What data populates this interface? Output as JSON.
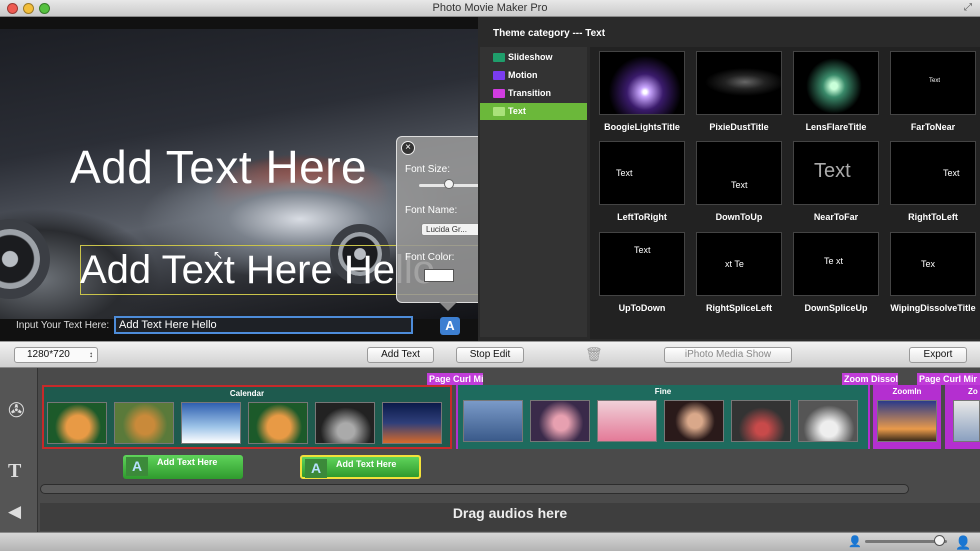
{
  "window": {
    "title": "Photo Movie Maker Pro"
  },
  "preview": {
    "overlay_text_1": "Add Text Here",
    "overlay_text_2": "Add Text Here Hello",
    "input_label": "Input Your Text Here:",
    "input_value": "Add Text Here Hello"
  },
  "font_popover": {
    "size_label": "Font Size:",
    "name_label": "Font Name:",
    "font_name_value": "Lucida Gr...",
    "color_label": "Font Color:",
    "font_size_level": 0.4
  },
  "theme": {
    "header": "Theme category --- Text",
    "categories": [
      {
        "label": "Slideshow",
        "color": "#1f9e6b"
      },
      {
        "label": "Motion",
        "color": "#7a3cf0"
      },
      {
        "label": "Transition",
        "color": "#d13ce0"
      },
      {
        "label": "Text",
        "color": "#6bb83a",
        "selected": true
      }
    ],
    "thumbnails": [
      {
        "label": "BoogieLightsTitle"
      },
      {
        "label": "PixieDustTitle"
      },
      {
        "label": "LensFlareTitle"
      },
      {
        "label": "FarToNear",
        "preview": "Text"
      },
      {
        "label": "LeftToRight",
        "preview": "Text"
      },
      {
        "label": "DownToUp",
        "preview": "Text"
      },
      {
        "label": "NearToFar",
        "preview": "Text"
      },
      {
        "label": "RightToLeft",
        "preview": "Text"
      },
      {
        "label": "UpToDown",
        "preview": "Text"
      },
      {
        "label": "RightSpliceLeft",
        "preview": "xt  Te"
      },
      {
        "label": "DownSpliceUp",
        "preview": "Te xt"
      },
      {
        "label": "WipingDissolveTitle",
        "preview": "Tex"
      }
    ]
  },
  "toolbar": {
    "resolution": "1280*720",
    "add_text": "Add Text",
    "stop_edit": "Stop Edit",
    "iphoto": "iPhoto Media Show",
    "export": "Export"
  },
  "timeline": {
    "segments": [
      {
        "name": "Calendar",
        "color": "#c62a2a"
      },
      {
        "name": "Fine",
        "color": "#1e7a6a"
      },
      {
        "name": "ZoomIn",
        "color": "#b42fd0"
      },
      {
        "name": "Zo",
        "color": "#b42fd0"
      }
    ],
    "transitions": [
      "Page Curl Mic",
      "Zoom Dissol",
      "Page Curl Mir"
    ],
    "text_clips": [
      "Add Text Here",
      "Add Text Here"
    ],
    "audio_placeholder": "Drag audios here"
  },
  "icons": {
    "film": "film-reel-icon",
    "text": "text-track-icon",
    "audio": "speaker-icon",
    "font": "font-icon",
    "trash": "trash-icon",
    "close": "close-icon"
  }
}
